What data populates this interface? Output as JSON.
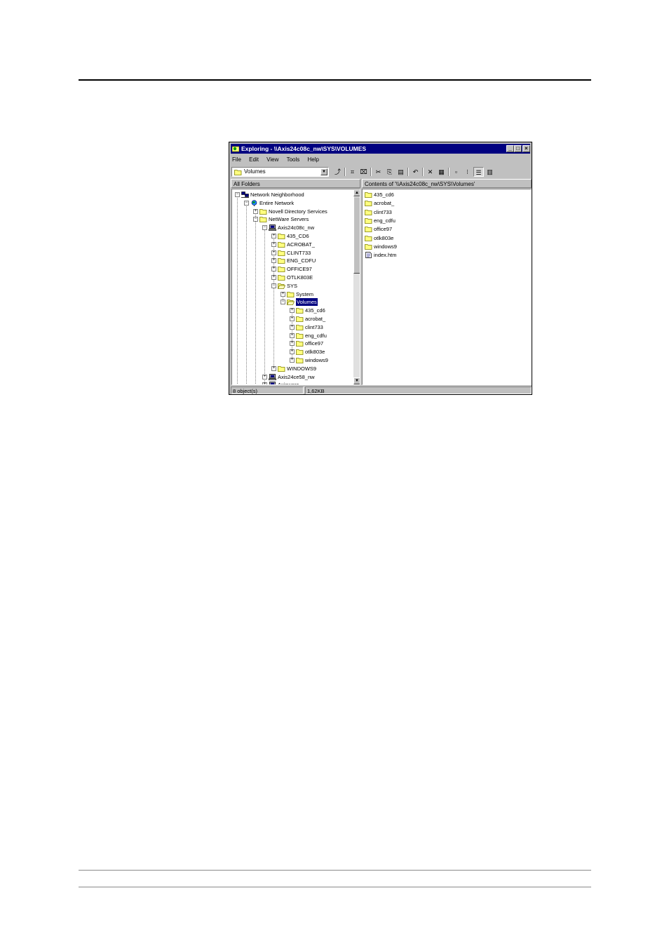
{
  "window": {
    "title": "Exploring - \\\\Axis24c08c_nw\\SYS\\VOLUMES",
    "controls": {
      "minimize": "_",
      "maximize": "□",
      "close": "×"
    }
  },
  "menu": [
    "File",
    "Edit",
    "View",
    "Tools",
    "Help"
  ],
  "address": {
    "value": "Volumes",
    "icon": "open-folder-icon"
  },
  "toolbar": [
    {
      "name": "up-one-level-icon",
      "glyph": "⤴"
    },
    {
      "name": "map-drive-icon",
      "glyph": "⌗"
    },
    {
      "name": "disconnect-drive-icon",
      "glyph": "⌧"
    },
    {
      "name": "cut-icon",
      "glyph": "✂"
    },
    {
      "name": "copy-icon",
      "glyph": "⎘"
    },
    {
      "name": "paste-icon",
      "glyph": "▤"
    },
    {
      "name": "undo-icon",
      "glyph": "↶"
    },
    {
      "name": "delete-icon",
      "glyph": "✕"
    },
    {
      "name": "properties-icon",
      "glyph": "▦"
    },
    {
      "name": "large-icons-icon",
      "glyph": "▫"
    },
    {
      "name": "small-icons-icon",
      "glyph": "⁝"
    },
    {
      "name": "list-view-icon",
      "glyph": "☰"
    },
    {
      "name": "details-view-icon",
      "glyph": "▥"
    }
  ],
  "left_header": "All Folders",
  "right_header": "Contents of '\\\\Axis24c08c_nw\\SYS\\Volumes'",
  "tree": [
    {
      "label": "Network Neighborhood",
      "level": 0,
      "exp": "−",
      "icon": "network-neighborhood-icon"
    },
    {
      "label": "Entire Network",
      "level": 1,
      "exp": "−",
      "icon": "globe-icon"
    },
    {
      "label": "Novell Directory Services",
      "level": 2,
      "exp": "+",
      "icon": "folder-icon"
    },
    {
      "label": "NetWare Servers",
      "level": 2,
      "exp": "−",
      "icon": "folder-icon"
    },
    {
      "label": "Axis24c08c_nw",
      "level": 3,
      "exp": "−",
      "icon": "computer-icon"
    },
    {
      "label": "435_CD6",
      "level": 4,
      "exp": "+",
      "icon": "folder-icon"
    },
    {
      "label": "ACROBAT_",
      "level": 4,
      "exp": "+",
      "icon": "folder-icon"
    },
    {
      "label": "CLINT733",
      "level": 4,
      "exp": "+",
      "icon": "folder-icon"
    },
    {
      "label": "ENG_CDFU",
      "level": 4,
      "exp": "+",
      "icon": "folder-icon"
    },
    {
      "label": "OFFICE97",
      "level": 4,
      "exp": "+",
      "icon": "folder-icon"
    },
    {
      "label": "OTLK803E",
      "level": 4,
      "exp": "+",
      "icon": "folder-icon"
    },
    {
      "label": "SYS",
      "level": 4,
      "exp": "−",
      "icon": "open-folder-icon"
    },
    {
      "label": "System",
      "level": 5,
      "exp": "+",
      "icon": "folder-icon"
    },
    {
      "label": "Volumes",
      "level": 5,
      "exp": "−",
      "icon": "open-folder-icon",
      "selected": true
    },
    {
      "label": "435_cd6",
      "level": 6,
      "exp": "+",
      "icon": "folder-icon"
    },
    {
      "label": "acrobat_",
      "level": 6,
      "exp": "+",
      "icon": "folder-icon"
    },
    {
      "label": "clint733",
      "level": 6,
      "exp": "+",
      "icon": "folder-icon"
    },
    {
      "label": "eng_cdfu",
      "level": 6,
      "exp": "+",
      "icon": "folder-icon"
    },
    {
      "label": "office97",
      "level": 6,
      "exp": "+",
      "icon": "folder-icon"
    },
    {
      "label": "otlk803e",
      "level": 6,
      "exp": "+",
      "icon": "folder-icon"
    },
    {
      "label": "windows9",
      "level": 6,
      "exp": "+",
      "icon": "folder-icon"
    },
    {
      "label": "WINDOWS9",
      "level": 4,
      "exp": "+",
      "icon": "folder-icon"
    },
    {
      "label": "Axis24ce58_nw",
      "level": 3,
      "exp": "+",
      "icon": "computer-icon"
    },
    {
      "label": "Axisware",
      "level": 3,
      "exp": "+",
      "icon": "computer-icon"
    }
  ],
  "contents": [
    {
      "label": "435_cd6",
      "icon": "folder-icon"
    },
    {
      "label": "acrobat_",
      "icon": "folder-icon"
    },
    {
      "label": "clint733",
      "icon": "folder-icon"
    },
    {
      "label": "eng_cdfu",
      "icon": "folder-icon"
    },
    {
      "label": "office97",
      "icon": "folder-icon"
    },
    {
      "label": "otlk803e",
      "icon": "folder-icon"
    },
    {
      "label": "windows9",
      "icon": "folder-icon"
    },
    {
      "label": "index.htm",
      "icon": "html-file-icon"
    }
  ],
  "status": {
    "objects": "8 object(s)",
    "size": "1,62KB"
  },
  "colors": {
    "titlebar": "#000080",
    "face": "#c0c0c0",
    "folder": "#ffff80",
    "selection": "#000080"
  }
}
